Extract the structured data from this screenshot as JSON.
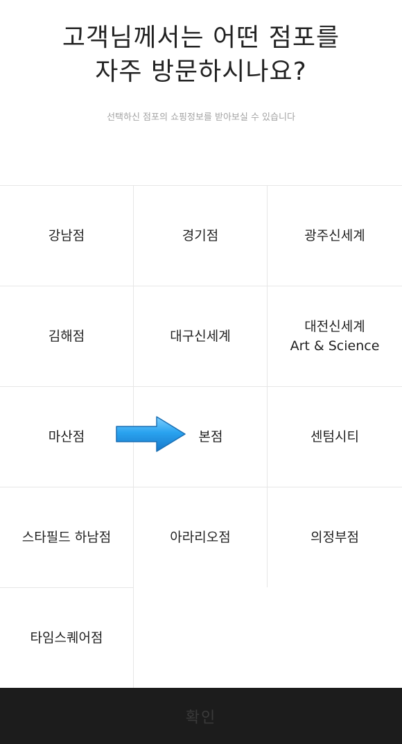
{
  "header": {
    "title_line1": "고객님께서는 어떤 점포를",
    "title_line2": "자주 방문하시나요?",
    "subtitle": "선택하신 점포의 쇼핑정보를 받아보실 수 있습니다"
  },
  "stores": [
    {
      "label": "강남점",
      "sublabel": ""
    },
    {
      "label": "경기점",
      "sublabel": ""
    },
    {
      "label": "광주신세계",
      "sublabel": ""
    },
    {
      "label": "김해점",
      "sublabel": ""
    },
    {
      "label": "대구신세계",
      "sublabel": ""
    },
    {
      "label": "대전신세계",
      "sublabel": "Art & Science"
    },
    {
      "label": "마산점",
      "sublabel": ""
    },
    {
      "label": "본점",
      "sublabel": ""
    },
    {
      "label": "센텀시티",
      "sublabel": ""
    },
    {
      "label": "스타필드 하남점",
      "sublabel": ""
    },
    {
      "label": "아라리오점",
      "sublabel": ""
    },
    {
      "label": "의정부점",
      "sublabel": ""
    },
    {
      "label": "타임스퀘어점",
      "sublabel": ""
    }
  ],
  "confirm_button": {
    "label": "확인"
  },
  "annotation": {
    "icon": "right-arrow-icon",
    "color": "#2aa3ef"
  }
}
